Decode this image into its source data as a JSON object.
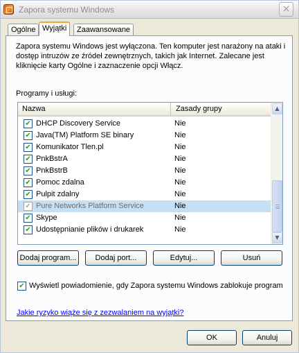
{
  "window": {
    "title": "Zapora systemu Windows",
    "close_glyph": "×"
  },
  "tabs": [
    {
      "label": "Ogólne"
    },
    {
      "label": "Wyjątki"
    },
    {
      "label": "Zaawansowane"
    }
  ],
  "exceptions": {
    "info": "Zapora systemu Windows jest wyłączona. Ten komputer jest narażony na ataki i dostęp intruzów ze źródeł zewnętrznych, takich jak Internet. Zalecane jest kliknięcie karty Ogólne i zaznaczenie opcji Włącz.",
    "programs_label": "Programy i usługi:",
    "columns": {
      "name": "Nazwa",
      "policy": "Zasady grupy"
    },
    "programs": [
      {
        "name": "DHCP Discovery Service",
        "policy": "Nie",
        "checked": "✔"
      },
      {
        "name": "Java(TM) Platform SE binary",
        "policy": "Nie",
        "checked": "✔"
      },
      {
        "name": "Komunikator Tlen.pl",
        "policy": "Nie",
        "checked": "✔"
      },
      {
        "name": "PnkBstrA",
        "policy": "Nie",
        "checked": "✔"
      },
      {
        "name": "PnkBstrB",
        "policy": "Nie",
        "checked": "✔"
      },
      {
        "name": "Pomoc zdalna",
        "policy": "Nie",
        "checked": "✔"
      },
      {
        "name": "Pulpit zdalny",
        "policy": "Nie",
        "checked": "✔"
      },
      {
        "name": "Pure Networks Platform Service",
        "policy": "Nie",
        "checked": "✔"
      },
      {
        "name": "Skype",
        "policy": "Nie",
        "checked": "✔"
      },
      {
        "name": "Udostępnianie plików i drukarek",
        "policy": "Nie",
        "checked": "✔"
      }
    ],
    "buttons": {
      "add_program": "Dodaj program...",
      "add_port": "Dodaj port...",
      "edit": "Edytuj...",
      "delete": "Usuń"
    },
    "notify_label": "Wyświetl powiadomienie, gdy Zapora systemu Windows zablokuje program",
    "notify_checked": "✔",
    "help_link": "Jakie ryzyko wiąże się z zezwalaniem na wyjątki?"
  },
  "footer": {
    "ok": "OK",
    "cancel": "Anuluj"
  },
  "colors": {
    "tab_accent": "#f0a53a",
    "selection": "#c4e0f2",
    "link": "#0000ff",
    "check": "#21a121"
  }
}
